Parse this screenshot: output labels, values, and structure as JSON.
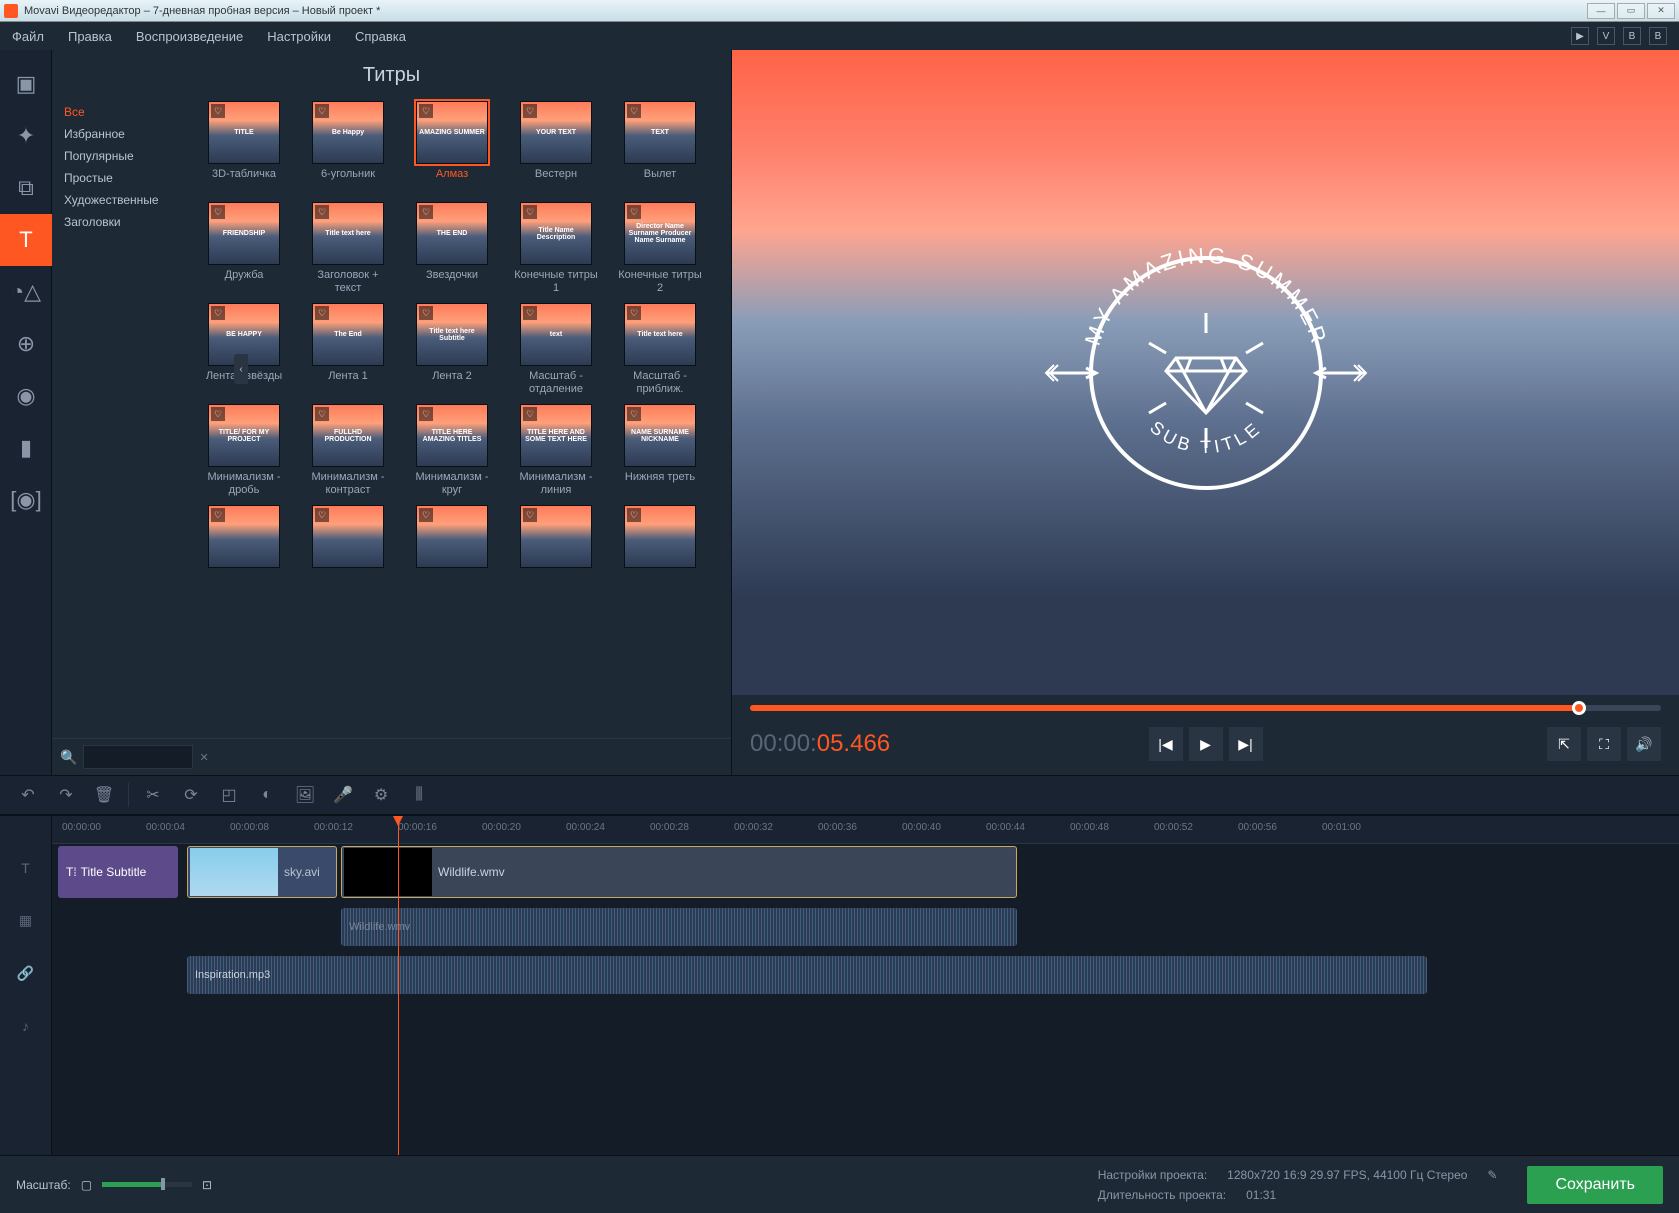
{
  "window": {
    "title": "Movavi Видеоредактор – 7-дневная пробная версия – Новый проект *"
  },
  "menu": {
    "file": "Файл",
    "edit": "Правка",
    "playback": "Воспроизведение",
    "settings": "Настройки",
    "help": "Справка"
  },
  "panel": {
    "header": "Титры"
  },
  "categories": [
    "Все",
    "Избранное",
    "Популярные",
    "Простые",
    "Художественные",
    "Заголовки"
  ],
  "thumbs": [
    [
      {
        "label": "3D-табличка",
        "ov": "TITLE"
      },
      {
        "label": "6-угольник",
        "ov": "Be Happy"
      },
      {
        "label": "Алмаз",
        "ov": "AMAZING SUMMER",
        "sel": true
      },
      {
        "label": "Вестерн",
        "ov": "YOUR TEXT"
      },
      {
        "label": "Вылет",
        "ov": "TEXT"
      }
    ],
    [
      {
        "label": "Дружба",
        "ov": "FRIENDSHIP"
      },
      {
        "label": "Заголовок + текст",
        "ov": "Title text here"
      },
      {
        "label": "Звездочки",
        "ov": "THE END"
      },
      {
        "label": "Конечные титры 1",
        "ov": "Title Name Description"
      },
      {
        "label": "Конечные титры 2",
        "ov": "Director Name Surname Producer Name Surname"
      }
    ],
    [
      {
        "label": "Лента - звёзды",
        "ov": "BE HAPPY"
      },
      {
        "label": "Лента 1",
        "ov": "The End"
      },
      {
        "label": "Лента 2",
        "ov": "Title text here Subtitle"
      },
      {
        "label": "Масштаб - отдаление",
        "ov": "text"
      },
      {
        "label": "Масштаб - приближ.",
        "ov": "Title text here"
      }
    ],
    [
      {
        "label": "Минимализм - дробь",
        "ov": "TITLE/ FOR MY PROJECT"
      },
      {
        "label": "Минимализм - контраст",
        "ov": "FULLHD PRODUCTION"
      },
      {
        "label": "Минимализм - круг",
        "ov": "TITLE HERE AMAZING TITLES"
      },
      {
        "label": "Минимализм - линия",
        "ov": "TITLE HERE AND SOME TEXT HERE"
      },
      {
        "label": "Нижняя треть",
        "ov": "NAME SURNAME NICKNAME"
      }
    ],
    [
      {
        "label": "",
        "ov": ""
      },
      {
        "label": "",
        "ov": ""
      },
      {
        "label": "",
        "ov": ""
      },
      {
        "label": "",
        "ov": ""
      },
      {
        "label": "",
        "ov": ""
      }
    ]
  ],
  "preview": {
    "arc_top": "MY AMAZING SUMMER",
    "arc_bottom": "SUB TITLE"
  },
  "timecode": {
    "pre": "00:00:",
    "hl": "05.466"
  },
  "ruler": [
    "00:00:00",
    "00:00:04",
    "00:00:08",
    "00:00:12",
    "00:00:16",
    "00:00:20",
    "00:00:24",
    "00:00:28",
    "00:00:32",
    "00:00:36",
    "00:00:40",
    "00:00:44",
    "00:00:48",
    "00:00:52",
    "00:00:56",
    "00:01:00"
  ],
  "clips": {
    "title": "Title Subtitle",
    "video1": "sky.avi",
    "video2": "Wildlife.wmv",
    "audio1": "Wildlife.wmv",
    "audio2": "Inspiration.mp3"
  },
  "bottom": {
    "zoom_label": "Масштаб:",
    "proj_settings_label": "Настройки проекта:",
    "proj_settings_value": "1280x720 16:9 29.97 FPS, 44100 Гц Стерео",
    "duration_label": "Длительность проекта:",
    "duration_value": "01:31",
    "save": "Сохранить"
  }
}
